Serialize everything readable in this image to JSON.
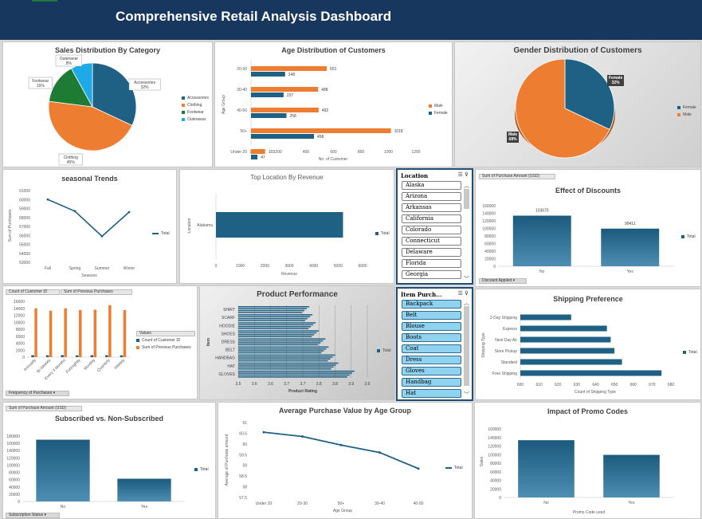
{
  "header": {
    "title": "Comprehensive Retail Analysis Dashboard"
  },
  "colors": {
    "blue": "#1f6185",
    "orange": "#ed7d31",
    "green": "#1e7b34",
    "cyan": "#1eaae6",
    "header": "#17375e"
  },
  "sales_category": {
    "title": "Sales Distribution By Category",
    "chart_data": {
      "type": "pie",
      "categories": [
        "Accessories",
        "Clothing",
        "Footwear",
        "Outerwear"
      ],
      "values": [
        32,
        45,
        15,
        8
      ],
      "labels": [
        "Accessories\n32%",
        "Clothing\n45%",
        "Footwear\n15%",
        "Outerwear\n8%"
      ]
    },
    "legend": [
      "Accessories",
      "Clothing",
      "Footwear",
      "Outerwear"
    ]
  },
  "age_dist": {
    "title": "Age Distribution of Customers",
    "ylabel": "Age Group",
    "xlabel": "No. of Customer",
    "chart_data": {
      "type": "bar",
      "categories": [
        "20-30",
        "30-40",
        "40-50",
        "50+",
        "Under 20"
      ],
      "series": [
        {
          "name": "Male",
          "values": [
            551,
            488,
            492,
            1018,
            103
          ]
        },
        {
          "name": "Female",
          "values": [
            248,
            237,
            258,
            458,
            47
          ]
        }
      ],
      "xticks": [
        "0",
        "200",
        "400",
        "600",
        "800",
        "1000",
        "1200"
      ],
      "xlim": [
        0,
        1200
      ]
    },
    "legend": [
      "Male",
      "Female"
    ]
  },
  "gender": {
    "title": "Gender Distribution of Customers",
    "chart_data": {
      "type": "pie",
      "categories": [
        "Female",
        "Male"
      ],
      "values": [
        32,
        68
      ]
    },
    "female_label": "Female",
    "female_pct": "32%",
    "male_label": "Male",
    "male_pct": "68%",
    "legend": [
      "Female",
      "Male"
    ]
  },
  "seasonal": {
    "title": "seasonal Trends",
    "ylabel": "Sum of Purchases",
    "xlabel": "Seasons",
    "chart_data": {
      "type": "line",
      "categories": [
        "Fall",
        "Spring",
        "Summer",
        "Winter"
      ],
      "values": [
        60000,
        58700,
        55900,
        58600
      ],
      "yticks": [
        "61000",
        "60000",
        "59000",
        "58000",
        "57000",
        "56000",
        "55000",
        "54000",
        "53000"
      ],
      "ylim": [
        53000,
        61000
      ]
    },
    "legend": "Total"
  },
  "location": {
    "title": "Top Location By Revenue",
    "ylabel": "Location",
    "xlabel": "Revenue",
    "chart_data": {
      "type": "bar",
      "categories": [
        "Alabama"
      ],
      "values": [
        5200
      ],
      "xticks": [
        "0",
        "1000",
        "2000",
        "3000",
        "4000",
        "5000",
        "6000"
      ],
      "xlim": [
        0,
        6000
      ]
    },
    "legend": "Total"
  },
  "location_slicer": {
    "header": "Location",
    "items": [
      "Alaska",
      "Arizona",
      "Arkansas",
      "California",
      "Colorado",
      "Connecticut",
      "Delaware",
      "Florida",
      "Georgia"
    ]
  },
  "discounts": {
    "title": "Effect of Discounts",
    "field_btn": "Sum of Purchase Amount (USD)",
    "filter_btn": "Discount Applied",
    "chart_data": {
      "type": "bar",
      "categories": [
        "No",
        "Yes"
      ],
      "values": [
        133670,
        99411
      ],
      "yticks": [
        "160000",
        "140000",
        "120000",
        "100000",
        "80000",
        "60000",
        "40000",
        "20000",
        "0"
      ],
      "ylim": [
        0,
        160000
      ]
    },
    "value_labels": [
      "133670",
      "99411"
    ],
    "legend": "Total"
  },
  "frequency": {
    "btn1": "Count of Customer ID",
    "btn2": "Sum of Previous Purchases",
    "filter_btn": "Frequency of Purchases",
    "chart_data": {
      "type": "bar",
      "categories": [
        "Annually",
        "Bi-Weekly",
        "Every 3 Months",
        "Fortnightly",
        "Monthly",
        "Quarterly",
        "Weekly"
      ],
      "series": [
        {
          "name": "Count of Customer ID",
          "values": [
            572,
            547,
            584,
            542,
            553,
            563,
            539
          ]
        },
        {
          "name": "Sum of Previous Purchases",
          "values": [
            14000,
            13300,
            14000,
            13500,
            13600,
            14900,
            13500
          ]
        }
      ],
      "yticks": [
        "16000",
        "14000",
        "12000",
        "10000",
        "8000",
        "6000",
        "4000",
        "2000",
        "0"
      ],
      "ylim": [
        0,
        16000
      ]
    },
    "legend_title": "Values",
    "legend": [
      "Count of Customer ID",
      "Sum of Previous Purchases"
    ]
  },
  "product": {
    "title": "Product Performance",
    "ylabel": "Item",
    "xlabel": "Product Rating",
    "chart_data": {
      "type": "bar",
      "categories": [
        "SHIRT",
        "SCARF",
        "HOODIE",
        "SHOES",
        "DRESS",
        "BELT",
        "HANDBAG",
        "HAT",
        "GLOVES"
      ],
      "values": [
        3.72,
        3.73,
        3.74,
        3.75,
        3.77,
        3.78,
        3.8,
        3.81,
        3.86
      ],
      "xticks": [
        "3.5",
        "3.6",
        "3.6",
        "3.7",
        "3.7",
        "3.8",
        "3.8",
        "3.9",
        "3.9"
      ],
      "xlim": [
        3.5,
        3.9
      ]
    },
    "legend": "Total"
  },
  "item_slicer": {
    "header": "Item Purch...",
    "items": [
      "Backpack",
      "Belt",
      "Blouse",
      "Boots",
      "Coat",
      "Dress",
      "Gloves",
      "Handbag",
      "Hat"
    ]
  },
  "shipping": {
    "title": "Shipping Preference",
    "ylabel": "Shipping Type",
    "xlabel": "Count of Shipping Type",
    "chart_data": {
      "type": "bar",
      "categories": [
        "2-Day Shipping",
        "Express",
        "Next Day Air",
        "Store Pickup",
        "Standard",
        "Free Shipping"
      ],
      "values": [
        627,
        646,
        648,
        650,
        654,
        675
      ],
      "xticks": [
        "600",
        "610",
        "620",
        "630",
        "640",
        "650",
        "660",
        "670",
        "680"
      ],
      "xlim": [
        600,
        680
      ]
    },
    "legend": "Total"
  },
  "subscribed": {
    "title": "Subscribed vs. Non-Subscribed",
    "field_btn": "Sum of Purchase Amount (USD)",
    "filter_btn": "Subscription Status",
    "chart_data": {
      "type": "bar",
      "categories": [
        "No",
        "Yes"
      ],
      "values": [
        170000,
        62600
      ],
      "yticks": [
        "180000",
        "160000",
        "140000",
        "120000",
        "100000",
        "80000",
        "60000",
        "40000",
        "20000",
        "0"
      ],
      "ylim": [
        0,
        180000
      ]
    },
    "legend": "Total"
  },
  "avg_purchase": {
    "title": "Average Purchase Value by Age Group",
    "ylabel": "Average of Purchase amount",
    "xlabel": "Age Group",
    "chart_data": {
      "type": "line",
      "categories": [
        "Under 20",
        "20-30",
        "50+",
        "30-40",
        "40-50"
      ],
      "values": [
        60.55,
        60.35,
        59.95,
        59.6,
        58.85
      ],
      "yticks": [
        "61",
        "60.5",
        "60",
        "59.5",
        "59",
        "58.5",
        "58",
        "57.5"
      ],
      "ylim": [
        57.5,
        61
      ]
    },
    "legend": "Total"
  },
  "promo": {
    "title": "Impact of Promo Codes",
    "ylabel": "Sales",
    "xlabel": "Promo Code used",
    "chart_data": {
      "type": "bar",
      "categories": [
        "No",
        "Yes"
      ],
      "values": [
        133670,
        99411
      ],
      "yticks": [
        "160000",
        "140000",
        "120000",
        "100000",
        "80000",
        "60000",
        "40000",
        "20000",
        "0"
      ],
      "ylim": [
        0,
        160000
      ]
    },
    "legend": "Total"
  }
}
